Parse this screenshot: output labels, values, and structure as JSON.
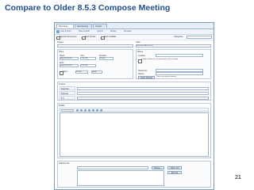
{
  "slide": {
    "title": "Compare to Older 8.5.3 Compose Meeting",
    "page_number": "21"
  },
  "app": {
    "tabs": [
      "Mail Cases",
      "New Meeting",
      "Contact"
    ],
    "toolbar": [
      "Save & Send",
      "Save as Draft",
      "Options",
      "Display",
      "Schedule"
    ],
    "options": {
      "request_responses": "Request Responses",
      "mark_private": "Mark Private",
      "mark_available": "Mark Available",
      "categories_label": "Categories"
    },
    "left": {
      "subject_label": "Subject",
      "when_label": "When",
      "starts_label": "Starts",
      "ends_label": "Ends",
      "time_label": "Time",
      "duration_label": "Duration",
      "start_date": "Wed 8/10/2016",
      "start_time": "1:00 PM",
      "end_date": "Wed 8/10/2016",
      "end_time": "1:30 PM",
      "duration": "30 min",
      "alarm_label": "Alarm",
      "privacy_label": "Private",
      "notify_label": "Notify"
    },
    "right": {
      "chair_label": "Chair",
      "chair_value": "Jeff Green/Acme/Org",
      "where_label": "Where",
      "location_label": "Location",
      "include_label": "Include conference call information in the Location",
      "resources_label": "Resources",
      "rooms_label": "Rooms",
      "online_meeting_label": "Online Meeting",
      "online_meeting_note": "There is no online meeting"
    },
    "invitees": {
      "label": "Invitees",
      "required": "Required",
      "optional": "Optional",
      "fyi": "FYI"
    },
    "details_label": "Details",
    "attachments": {
      "label": "Attachments",
      "browse": "Browse...",
      "add_list": "Add to List",
      "remove": "Remove"
    }
  }
}
